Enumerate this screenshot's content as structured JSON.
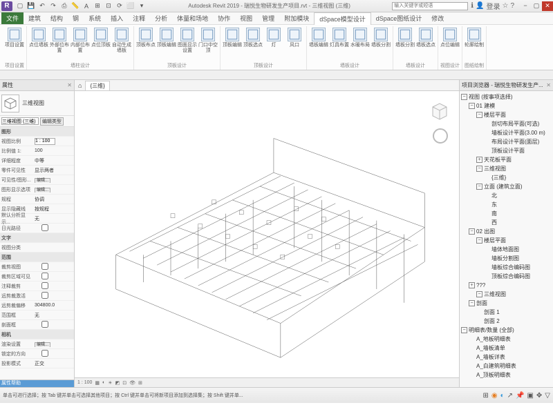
{
  "titlebar": {
    "app": "Autodesk Revit 2019",
    "doc": "瑞悦生物研发生产项目.rvt",
    "view": "三维视图 (三维)",
    "search_placeholder": "输入关键字或短语",
    "user": "登录"
  },
  "menutabs": [
    "文件",
    "建筑",
    "结构",
    "钢",
    "系统",
    "插入",
    "注释",
    "分析",
    "体量和场地",
    "协作",
    "视图",
    "管理",
    "附加模块",
    "dSpace模型设计",
    "dSpace图纸设计",
    "修改"
  ],
  "active_tab_index": 13,
  "ribbon": {
    "groups": [
      {
        "label": "项目设置",
        "items": [
          {
            "label": "项目设置"
          }
        ]
      },
      {
        "label": "墙柱设计",
        "items": [
          {
            "label": "点位墙板"
          },
          {
            "label": "外部位布置"
          },
          {
            "label": "内部位布置"
          },
          {
            "label": "点位顶板"
          },
          {
            "label": "自动生成墙板"
          }
        ]
      },
      {
        "label": "顶板设计",
        "items": [
          {
            "label": "顶板布点"
          },
          {
            "label": "顶板编辑"
          },
          {
            "label": "图面显示设置"
          },
          {
            "label": "门口中空顶"
          }
        ]
      },
      {
        "label": "顶板设计",
        "items": [
          {
            "label": "顶板编辑"
          },
          {
            "label": "顶板选点"
          },
          {
            "label": "灯"
          },
          {
            "label": "风口"
          }
        ]
      },
      {
        "label": "墙板设计",
        "items": [
          {
            "label": "墙板编辑"
          },
          {
            "label": "灯具布置"
          },
          {
            "label": "水暖布局"
          },
          {
            "label": "墙板分割"
          }
        ]
      },
      {
        "label": "墙板设计",
        "items": [
          {
            "label": "墙板分割"
          },
          {
            "label": "墙板选点"
          }
        ]
      },
      {
        "label": "视图设计",
        "items": [
          {
            "label": "点位编辑"
          }
        ]
      },
      {
        "label": "图纸绘制",
        "items": [
          {
            "label": "轮廓绘制"
          }
        ]
      }
    ]
  },
  "properties": {
    "title": "属性",
    "type_name": "三维视图",
    "selector_label": "三维视图 (三维)",
    "edit_type_btn": "编辑类型",
    "rows": [
      {
        "section": "图形"
      },
      {
        "k": "视图比例",
        "v": "1 : 100",
        "input": true
      },
      {
        "k": "比例值 1:",
        "v": "100"
      },
      {
        "k": "详细程度",
        "v": "中等"
      },
      {
        "k": "零件可见性",
        "v": "显示两者"
      },
      {
        "k": "可见性/图形...",
        "v": "",
        "btn": "编辑..."
      },
      {
        "k": "图形显示选项",
        "v": "",
        "btn": "编辑..."
      },
      {
        "k": "规程",
        "v": "协调"
      },
      {
        "k": "显示隐藏线",
        "v": "按规程"
      },
      {
        "k": "默认分析显示...",
        "v": "无"
      },
      {
        "k": "日光路径",
        "v": "",
        "check": false
      },
      {
        "section": "文字"
      },
      {
        "k": "视图分类",
        "v": ""
      },
      {
        "section": "范围"
      },
      {
        "k": "裁剪视图",
        "v": "",
        "check": false
      },
      {
        "k": "裁剪区域可见",
        "v": "",
        "check": false
      },
      {
        "k": "注释裁剪",
        "v": "",
        "check": false
      },
      {
        "k": "远剪裁激活",
        "v": "",
        "check": false
      },
      {
        "k": "远剪裁偏移",
        "v": "304800.0"
      },
      {
        "k": "范围框",
        "v": "无"
      },
      {
        "k": "剖面框",
        "v": "",
        "check": false
      },
      {
        "section": "相机"
      },
      {
        "k": "渲染设置",
        "v": "",
        "btn": "编辑..."
      },
      {
        "k": "锁定的方向",
        "v": "",
        "check": false
      },
      {
        "k": "投影模式",
        "v": "正交"
      }
    ],
    "footer": "属性帮助"
  },
  "viewtabs": [
    "{三维}"
  ],
  "view_controls": {
    "scale": "1 : 100"
  },
  "browser": {
    "title": "项目浏览器 - 瑞悦生物研发生产...",
    "tree": [
      {
        "d": 0,
        "t": "视图 (按事项选择)",
        "open": true
      },
      {
        "d": 1,
        "t": "01 建模",
        "open": true
      },
      {
        "d": 2,
        "t": "楼层平面",
        "open": true
      },
      {
        "d": 3,
        "t": "剖切布局平面(可选)"
      },
      {
        "d": 3,
        "t": "墙板设计平面(3.00 m)"
      },
      {
        "d": 3,
        "t": "布局设计平面(面层)"
      },
      {
        "d": 3,
        "t": "顶板设计平面"
      },
      {
        "d": 2,
        "t": "天花板平面",
        "open": false
      },
      {
        "d": 2,
        "t": "三维视图",
        "open": true
      },
      {
        "d": 3,
        "t": "{三维}"
      },
      {
        "d": 2,
        "t": "立面 (建筑立面)",
        "open": true
      },
      {
        "d": 3,
        "t": "北"
      },
      {
        "d": 3,
        "t": "东"
      },
      {
        "d": 3,
        "t": "南"
      },
      {
        "d": 3,
        "t": "西"
      },
      {
        "d": 1,
        "t": "02 出图",
        "open": true
      },
      {
        "d": 2,
        "t": "楼层平面",
        "open": true
      },
      {
        "d": 3,
        "t": "墙体地面图"
      },
      {
        "d": 3,
        "t": "墙板分割图"
      },
      {
        "d": 3,
        "t": "墙板综合编码图"
      },
      {
        "d": 3,
        "t": "顶板综合编码图"
      },
      {
        "d": 1,
        "t": "???",
        "open": false
      },
      {
        "d": 2,
        "t": "三维视图",
        "open": true
      },
      {
        "d": 1,
        "t": "剖面",
        "open": true
      },
      {
        "d": 2,
        "t": "剖面 1"
      },
      {
        "d": 2,
        "t": "剖面 2"
      },
      {
        "d": 0,
        "t": "明细表/数量 (全部)",
        "open": true
      },
      {
        "d": 1,
        "t": "A_地板明细表"
      },
      {
        "d": 1,
        "t": "A_墙板清单"
      },
      {
        "d": 1,
        "t": "A_墙板详表"
      },
      {
        "d": 1,
        "t": "A_白建筑明细表"
      },
      {
        "d": 1,
        "t": "A_顶板明细表"
      }
    ]
  },
  "statusbar": {
    "hint": "单击可进行选择；按 Tab 键并单击可选择其他项目；按 Ctrl 键并单击可将新项目添加到选择集；按 Shift 键并单..."
  }
}
